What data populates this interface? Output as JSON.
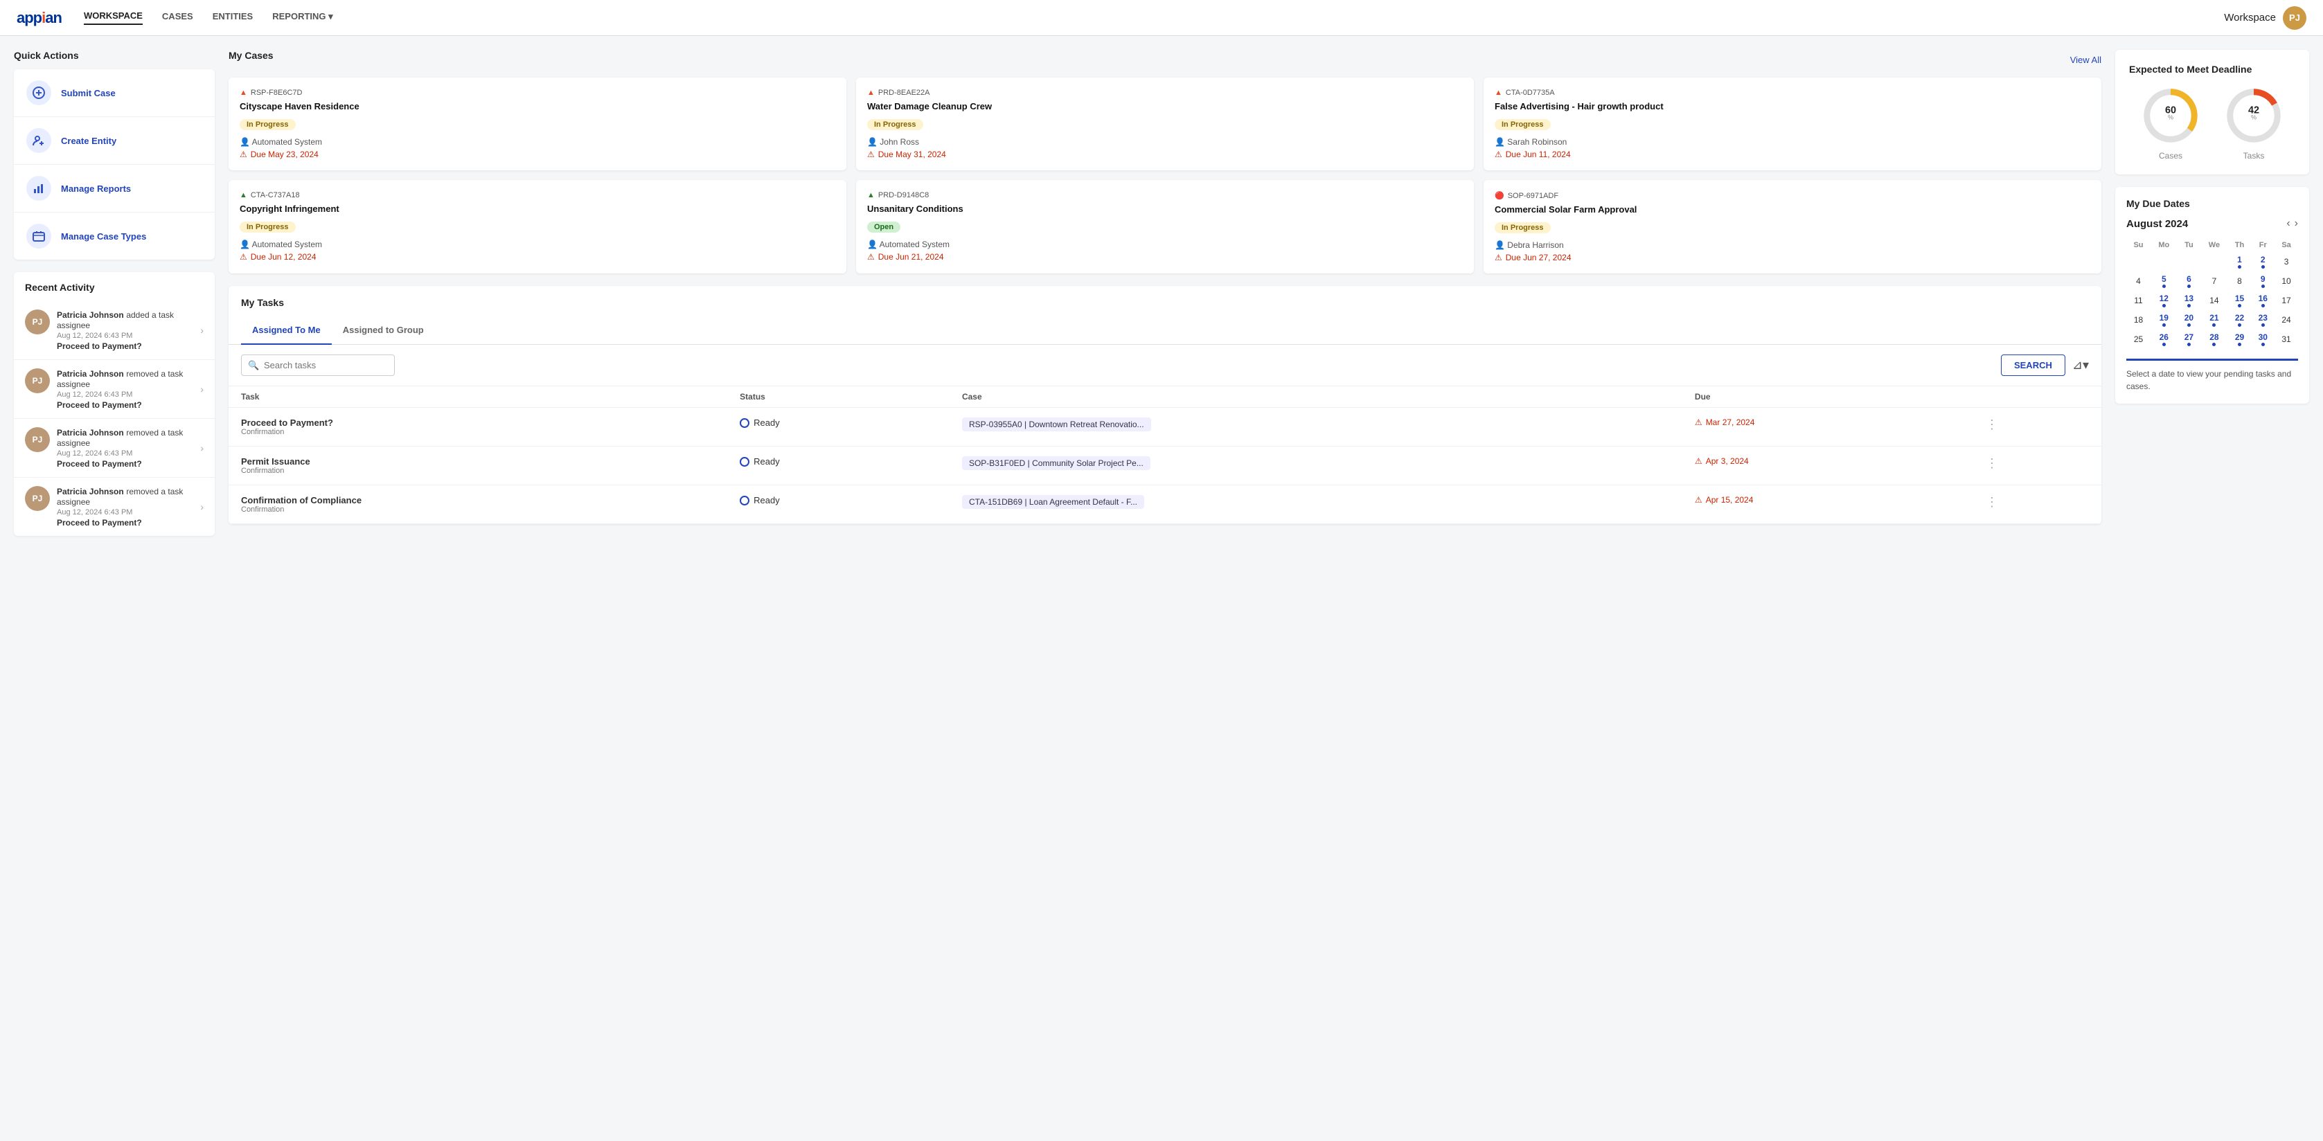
{
  "nav": {
    "logo": "appian",
    "links": [
      {
        "label": "WORKSPACE",
        "active": true
      },
      {
        "label": "CASES",
        "active": false
      },
      {
        "label": "ENTITIES",
        "active": false
      },
      {
        "label": "REPORTING",
        "active": false,
        "hasDropdown": true
      }
    ],
    "workspace_label": "Workspace",
    "workspace_dropdown": true
  },
  "quickActions": {
    "title": "Quick Actions",
    "items": [
      {
        "id": "submit-case",
        "label": "Submit Case",
        "icon": "+"
      },
      {
        "id": "create-entity",
        "label": "Create Entity",
        "icon": "person+"
      },
      {
        "id": "manage-reports",
        "label": "Manage Reports",
        "icon": "chart"
      },
      {
        "id": "manage-case-types",
        "label": "Manage Case Types",
        "icon": "folder"
      }
    ]
  },
  "recentActivity": {
    "title": "Recent Activity",
    "items": [
      {
        "name": "Patricia Johnson",
        "action": "added a task assignee",
        "time": "Aug 12, 2024 6:43 PM",
        "link": "Proceed to Payment?"
      },
      {
        "name": "Patricia Johnson",
        "action": "removed a task assignee",
        "time": "Aug 12, 2024 6:43 PM",
        "link": "Proceed to Payment?"
      },
      {
        "name": "Patricia Johnson",
        "action": "removed a task assignee",
        "time": "Aug 12, 2024 6:43 PM",
        "link": "Proceed to Payment?"
      },
      {
        "name": "Patricia Johnson",
        "action": "removed a task assignee",
        "time": "Aug 12, 2024 6:43 PM",
        "link": "Proceed to Payment?"
      }
    ]
  },
  "myCases": {
    "title": "My Cases",
    "viewAll": "View All",
    "cases": [
      {
        "id": "RSP-F8E6C7D",
        "title": "Cityscape Haven Residence",
        "flag": "🔴",
        "status": "In Progress",
        "statusType": "progress",
        "assignee": "Automated System",
        "due": "Due May 23, 2024"
      },
      {
        "id": "PRD-8EAE22A",
        "title": "Water Damage Cleanup Crew",
        "flag": "🔴",
        "status": "In Progress",
        "statusType": "progress",
        "assignee": "John Ross",
        "due": "Due May 31, 2024"
      },
      {
        "id": "CTA-0D7735A",
        "title": "False Advertising - Hair growth product",
        "flag": "🔴",
        "status": "In Progress",
        "statusType": "progress",
        "assignee": "Sarah Robinson",
        "due": "Due Jun 11, 2024"
      },
      {
        "id": "CTA-C737A18",
        "title": "Copyright Infringement",
        "flag": "🟢",
        "status": "In Progress",
        "statusType": "progress",
        "assignee": "Automated System",
        "due": "Due Jun 12, 2024"
      },
      {
        "id": "PRD-D9148C8",
        "title": "Unsanitary Conditions",
        "flag": "🟢",
        "status": "Open",
        "statusType": "open",
        "assignee": "Automated System",
        "due": "Due Jun 21, 2024"
      },
      {
        "id": "SOP-6971ADF",
        "title": "Commercial Solar Farm Approval",
        "flag": "🔴",
        "status": "In Progress",
        "statusType": "progress",
        "assignee": "Debra Harrison",
        "due": "Due Jun 27, 2024"
      }
    ]
  },
  "myTasks": {
    "title": "My Tasks",
    "tabs": [
      "Assigned To Me",
      "Assigned to Group"
    ],
    "activeTab": 0,
    "searchPlaceholder": "Search tasks",
    "searchButtonLabel": "SEARCH",
    "columns": [
      "Task",
      "Status",
      "Case",
      "Due"
    ],
    "rows": [
      {
        "taskName": "Proceed to Payment?",
        "taskSub": "Confirmation",
        "status": "Ready",
        "caseLabel": "RSP-03955A0 | Downtown Retreat Renovatio...",
        "due": "Mar 27, 2024"
      },
      {
        "taskName": "Permit Issuance",
        "taskSub": "Confirmation",
        "status": "Ready",
        "caseLabel": "SOP-B31F0ED | Community Solar Project Pe...",
        "due": "Apr 3, 2024"
      },
      {
        "taskName": "Confirmation of Compliance",
        "taskSub": "Confirmation",
        "status": "Ready",
        "caseLabel": "CTA-151DB69 | Loan Agreement Default - F...",
        "due": "Apr 15, 2024"
      }
    ]
  },
  "deadline": {
    "title": "Expected to Meet Deadline",
    "cases": {
      "percent": "60",
      "label": "Cases",
      "color": "#f0b429",
      "bgColor": "#e0e0e0"
    },
    "tasks": {
      "percent": "42",
      "label": "Tasks",
      "color": "#e84c22",
      "bgColor": "#e0e0e0"
    }
  },
  "calendar": {
    "title": "My Due Dates",
    "month": "August 2024",
    "dayHeaders": [
      "Su",
      "Mo",
      "Tu",
      "We",
      "Th",
      "Fr",
      "Sa"
    ],
    "hint": "Select a date to view your pending tasks and cases.",
    "weeks": [
      [
        null,
        null,
        null,
        null,
        "1",
        "2",
        "3"
      ],
      [
        "4",
        "5",
        "6",
        "7",
        "8",
        "9",
        "10"
      ],
      [
        "11",
        "12",
        "13",
        "14",
        "15",
        "16",
        "17"
      ],
      [
        "18",
        "19",
        "20",
        "21",
        "22",
        "23",
        "24"
      ],
      [
        "25",
        "26",
        "27",
        "28",
        "29",
        "30",
        "31"
      ]
    ],
    "eventDays": [
      "1",
      "2",
      "5",
      "6",
      "9",
      "12",
      "13",
      "15",
      "16",
      "19",
      "20",
      "21",
      "22",
      "23",
      "26",
      "27",
      "28",
      "29",
      "30"
    ]
  }
}
